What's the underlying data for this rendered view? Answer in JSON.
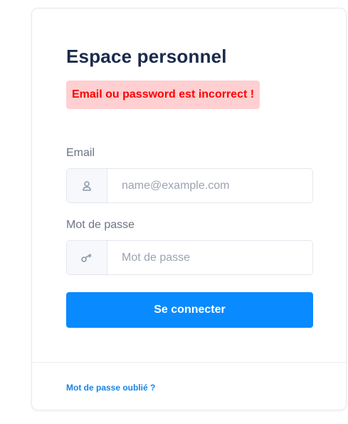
{
  "login": {
    "title": "Espace personnel",
    "error_message": "Email ou password est incorrect !",
    "email_label": "Email",
    "email_placeholder": "name@example.com",
    "email_value": "",
    "password_label": "Mot de passe",
    "password_placeholder": "Mot de passe",
    "password_value": "",
    "submit_label": "Se connecter",
    "forgot_link": "Mot de passe oublié ?"
  },
  "icons": {
    "email": "user-icon",
    "password": "key-icon"
  },
  "colors": {
    "title": "#1b2a4c",
    "error_text": "#ff0000",
    "error_background": "#ffcfd1",
    "primary": "#0a8aff",
    "link": "#1783e8"
  }
}
